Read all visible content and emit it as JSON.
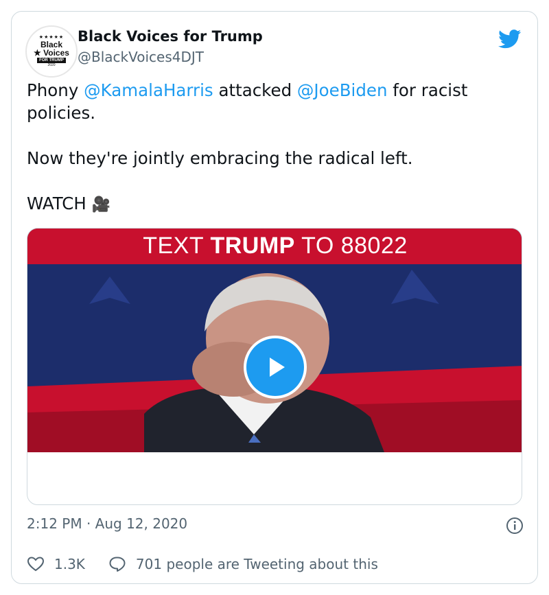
{
  "tweet": {
    "author_name": "Black Voices for Trump",
    "handle": "@BlackVoices4DJT",
    "avatar": {
      "line1": "Black",
      "line2": "★ Voices",
      "line3": "FOR TRUMP",
      "line4": "2020",
      "stars": "★★★★★"
    },
    "text": {
      "p1_a": "Phony ",
      "mention1": "@KamalaHarris",
      "p1_b": " attacked ",
      "mention2": "@JoeBiden",
      "p1_c": " for racist policies.",
      "p2": "Now they're jointly embracing the radical left.",
      "p3": "WATCH ",
      "camera_emoji": "🎥"
    },
    "video": {
      "banner_pre": "TEXT ",
      "banner_bold": "TRUMP",
      "banner_post": " TO 88022"
    },
    "timestamp": "2:12 PM · Aug 12, 2020",
    "likes": "1.3K",
    "tweeting_about": "701 people are Tweeting about this"
  },
  "colors": {
    "accent": "#1d9bf0",
    "banner_red": "#c8102e",
    "stage_blue": "#1c2d6b"
  },
  "icons": [
    "twitter-bird-icon",
    "play-icon",
    "info-icon",
    "heart-icon",
    "reply-bubble-icon",
    "video-camera-icon"
  ]
}
